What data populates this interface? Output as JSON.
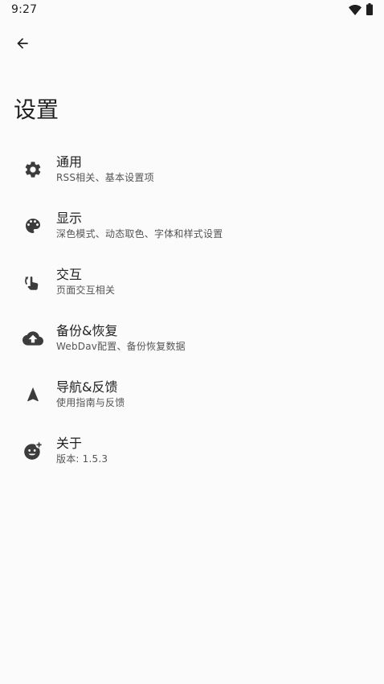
{
  "status_bar": {
    "time": "9:27",
    "icons": [
      "wifi-icon",
      "battery-icon"
    ]
  },
  "header": {
    "back_icon": "arrow-left-icon",
    "title": "设置"
  },
  "settings": [
    {
      "icon": "gear-icon",
      "title": "通用",
      "subtitle": "RSS相关、基本设置项"
    },
    {
      "icon": "palette-icon",
      "title": "显示",
      "subtitle": "深色模式、动态取色、字体和样式设置"
    },
    {
      "icon": "swipe-hand-icon",
      "title": "交互",
      "subtitle": "页面交互相关"
    },
    {
      "icon": "cloud-upload-icon",
      "title": "备份&恢复",
      "subtitle": "WebDav配置、备份恢复数据"
    },
    {
      "icon": "navigation-icon",
      "title": "导航&反馈",
      "subtitle": "使用指南与反馈"
    },
    {
      "icon": "emoji-add-icon",
      "title": "关于",
      "subtitle": "版本: 1.5.3"
    }
  ],
  "colors": {
    "background": "#fbfbfb",
    "text": "#1f1f1f",
    "subtext": "#555555",
    "icon": "#3c3c3c"
  }
}
